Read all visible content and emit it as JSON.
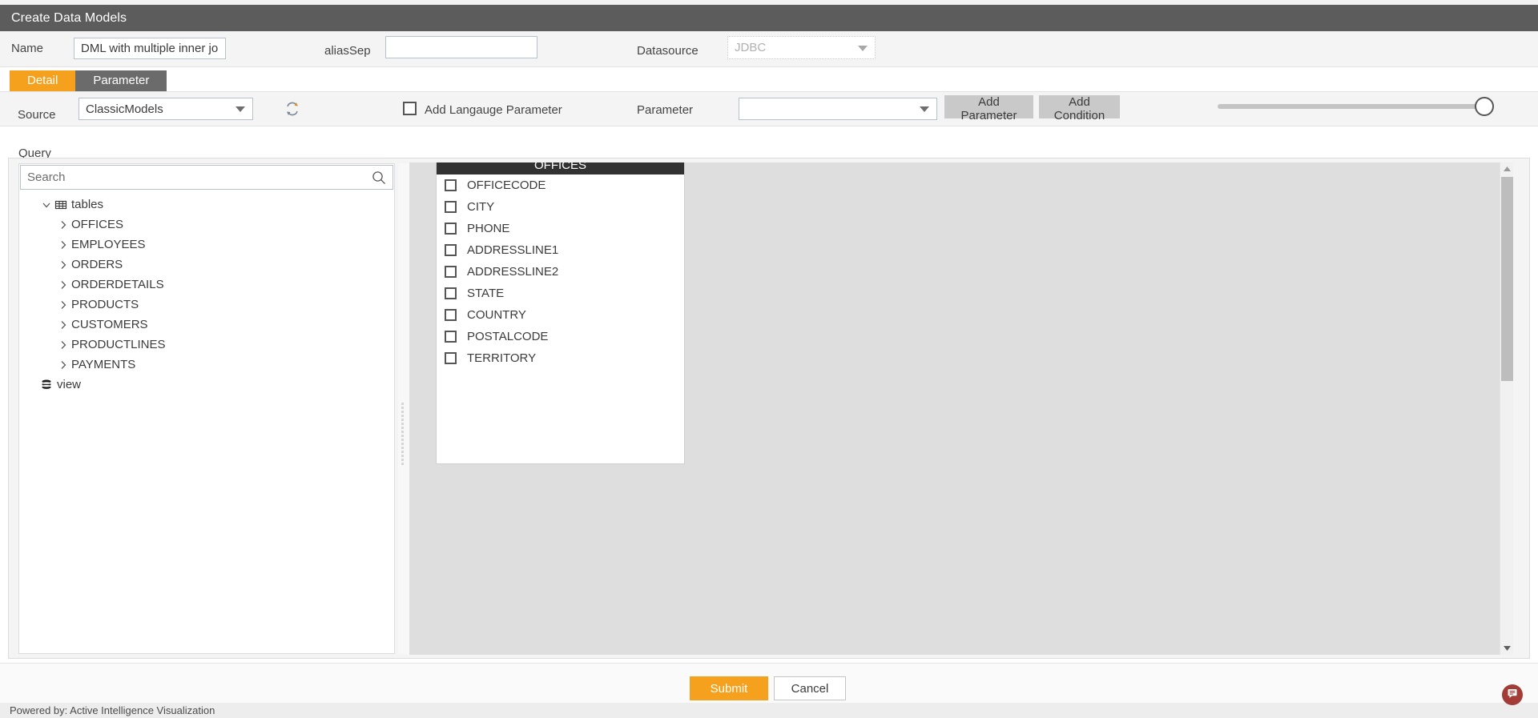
{
  "window": {
    "title": "Create Data Models"
  },
  "header": {
    "name_label": "Name",
    "name_value": "DML with multiple inner jo",
    "aliassep_label": "aliasSep",
    "aliassep_value": "",
    "datasource_label": "Datasource",
    "datasource_value": "JDBC"
  },
  "tabs": [
    {
      "label": "Detail",
      "active": true
    },
    {
      "label": "Parameter",
      "active": false
    }
  ],
  "toolbar": {
    "source_label": "Source",
    "source_value": "ClassicModels",
    "refresh_icon": "refresh-icon",
    "lang_param_label": "Add Langauge Parameter",
    "lang_param_checked": false,
    "parameter_label": "Parameter",
    "parameter_value": "",
    "add_parameter_label": "Add Parameter",
    "add_condition_label": "Add Condition",
    "zoom_slider_value": 100
  },
  "query": {
    "section_label": "Query",
    "search_placeholder": "Search",
    "search_value": "",
    "search_icon": "search-icon",
    "tree": [
      {
        "label": "tables",
        "icon": "table-grid-icon",
        "expanded": true,
        "level": 0
      },
      {
        "label": "OFFICES",
        "icon": "chevron-right-icon",
        "expanded": false,
        "level": 1
      },
      {
        "label": "EMPLOYEES",
        "icon": "chevron-right-icon",
        "expanded": false,
        "level": 1
      },
      {
        "label": "ORDERS",
        "icon": "chevron-right-icon",
        "expanded": false,
        "level": 1
      },
      {
        "label": "ORDERDETAILS",
        "icon": "chevron-right-icon",
        "expanded": false,
        "level": 1
      },
      {
        "label": "PRODUCTS",
        "icon": "chevron-right-icon",
        "expanded": false,
        "level": 1
      },
      {
        "label": "CUSTOMERS",
        "icon": "chevron-right-icon",
        "expanded": false,
        "level": 1
      },
      {
        "label": "PRODUCTLINES",
        "icon": "chevron-right-icon",
        "expanded": false,
        "level": 1
      },
      {
        "label": "PAYMENTS",
        "icon": "chevron-right-icon",
        "expanded": false,
        "level": 1
      },
      {
        "label": "view",
        "icon": "database-stack-icon",
        "expanded": false,
        "level": 0
      }
    ]
  },
  "canvas": {
    "table_card": {
      "title": "OFFICES",
      "columns": [
        {
          "name": "OFFICECODE",
          "checked": false
        },
        {
          "name": "CITY",
          "checked": false
        },
        {
          "name": "PHONE",
          "checked": false
        },
        {
          "name": "ADDRESSLINE1",
          "checked": false
        },
        {
          "name": "ADDRESSLINE2",
          "checked": false
        },
        {
          "name": "STATE",
          "checked": false
        },
        {
          "name": "COUNTRY",
          "checked": false
        },
        {
          "name": "POSTALCODE",
          "checked": false
        },
        {
          "name": "TERRITORY",
          "checked": false
        }
      ]
    }
  },
  "footer": {
    "submit_label": "Submit",
    "cancel_label": "Cancel",
    "powered_by": "Powered by: Active Intelligence Visualization",
    "chat_icon": "chat-bubble-icon"
  },
  "colors": {
    "titlebar": "#5c5c5c",
    "accent_orange": "#f5a11d",
    "tab_inactive": "#6b6b6b",
    "card_header": "#323232",
    "canvas_bg": "#dedede",
    "button_gray": "#c9c9c9",
    "chat_fab": "#a33b37"
  }
}
